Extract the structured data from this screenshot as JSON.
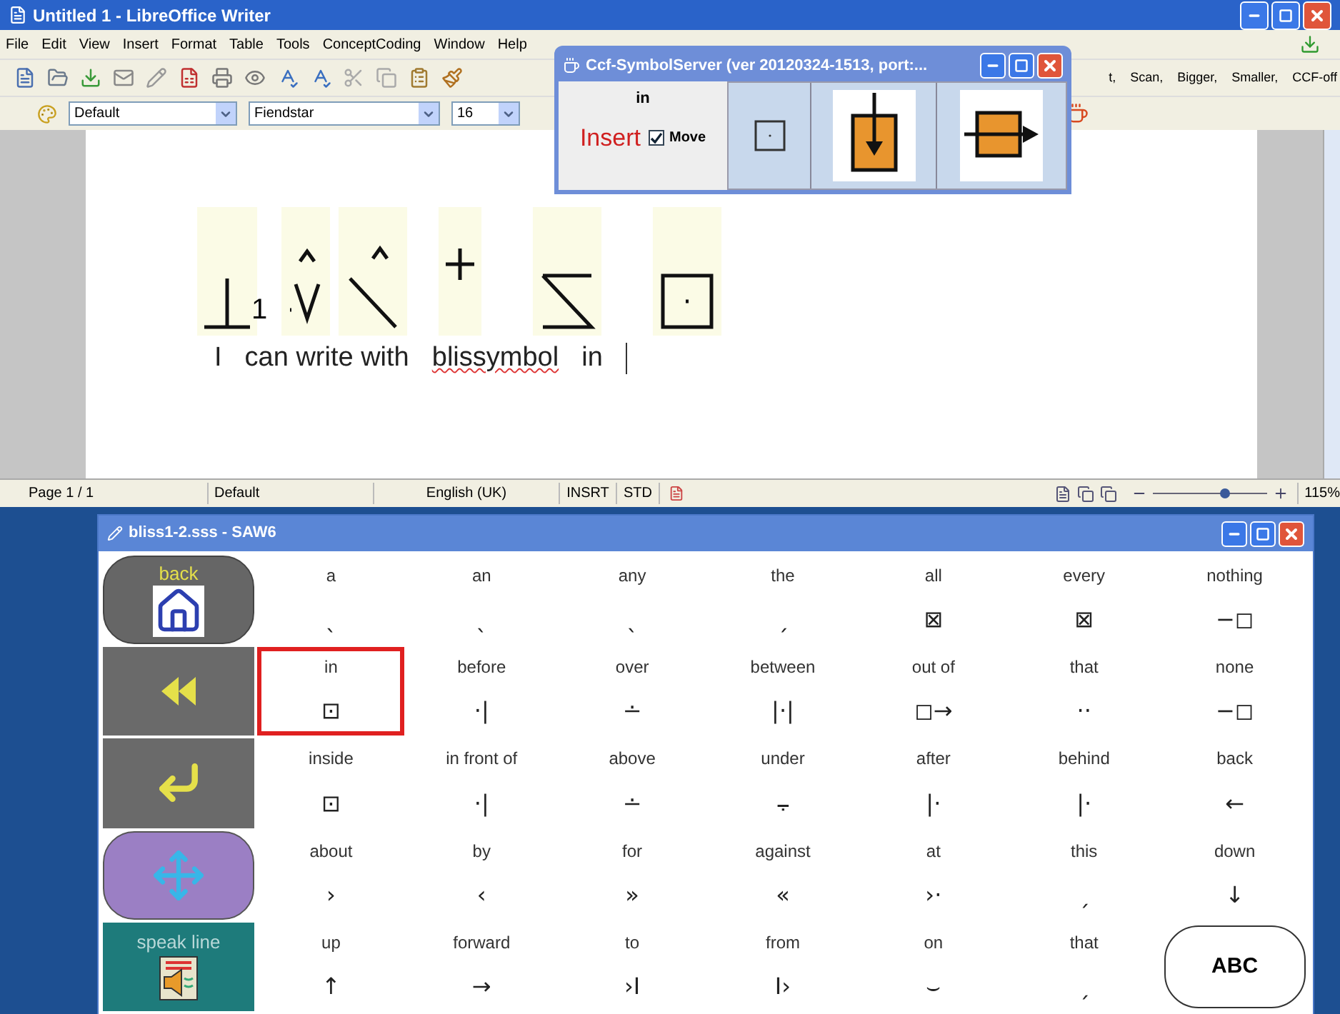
{
  "main_window": {
    "title": "Untitled 1 - LibreOffice Writer"
  },
  "menu": [
    "File",
    "Edit",
    "View",
    "Insert",
    "Format",
    "Table",
    "Tools",
    "ConceptCoding",
    "Window",
    "Help"
  ],
  "toolbar_commands": [
    "t,",
    "Scan,",
    "Bigger,",
    "Smaller,",
    "CCF-off"
  ],
  "format_bar": {
    "style": "Default",
    "font": "Fiendstar",
    "size": "16"
  },
  "symbol_server": {
    "title": "Ccf-SymbolServer (ver 20120324-1513, port:...",
    "word": "in",
    "action": "Insert",
    "move": {
      "label": "Move",
      "checked": true
    }
  },
  "document": {
    "subscript": "1",
    "words": [
      {
        "text": "I",
        "misspelled": false
      },
      {
        "text": "can write with",
        "misspelled": false
      },
      {
        "text": "blissymbol",
        "misspelled": true
      },
      {
        "text": "in",
        "misspelled": false
      }
    ]
  },
  "status_bar": {
    "page": "Page 1 / 1",
    "style": "Default",
    "language": "English (UK)",
    "mode": "INSRT",
    "selection": "STD",
    "zoom": {
      "level": 0.62,
      "reading": "115%"
    }
  },
  "saw": {
    "title": "bliss1-2.sss - SAW6",
    "side_buttons": [
      {
        "kind": "back",
        "label": "back"
      },
      {
        "kind": "rewind"
      },
      {
        "kind": "enter"
      },
      {
        "kind": "move"
      },
      {
        "kind": "speak",
        "label": "speak line"
      }
    ],
    "rows": [
      [
        {
          "word": "a",
          "symbol": "ˎ",
          "selected": false
        },
        {
          "word": "an",
          "symbol": "ˎ",
          "selected": false
        },
        {
          "word": "any",
          "symbol": "ˎ",
          "selected": false
        },
        {
          "word": "the",
          "symbol": "ˏ",
          "selected": false
        },
        {
          "word": "all",
          "symbol": "⊠",
          "selected": false
        },
        {
          "word": "every",
          "symbol": "⊠",
          "selected": false
        },
        {
          "word": "nothing",
          "symbol": "−◻",
          "selected": false
        }
      ],
      [
        {
          "word": "in",
          "symbol": "⊡",
          "selected": true
        },
        {
          "word": "before",
          "symbol": "·|",
          "selected": false
        },
        {
          "word": "over",
          "symbol": "∸",
          "selected": false
        },
        {
          "word": "between",
          "symbol": "|·|",
          "selected": false
        },
        {
          "word": "out of",
          "symbol": "◻→",
          "selected": false
        },
        {
          "word": "that",
          "symbol": "··",
          "selected": false
        },
        {
          "word": "none",
          "symbol": "−◻",
          "selected": false
        }
      ],
      [
        {
          "word": "inside",
          "symbol": "⊡",
          "selected": false
        },
        {
          "word": "in front of",
          "symbol": "·|",
          "selected": false
        },
        {
          "word": "above",
          "symbol": "∸",
          "selected": false
        },
        {
          "word": "under",
          "symbol": "⨪",
          "selected": false
        },
        {
          "word": "after",
          "symbol": "|·",
          "selected": false
        },
        {
          "word": "behind",
          "symbol": "|·",
          "selected": false
        },
        {
          "word": "back",
          "symbol": "←",
          "selected": false
        }
      ],
      [
        {
          "word": "about",
          "symbol": "›",
          "selected": false
        },
        {
          "word": "by",
          "symbol": "‹",
          "selected": false
        },
        {
          "word": "for",
          "symbol": "»",
          "selected": false
        },
        {
          "word": "against",
          "symbol": "«",
          "selected": false
        },
        {
          "word": "at",
          "symbol": "›·",
          "selected": false
        },
        {
          "word": "this",
          "symbol": "ˏ",
          "selected": false
        },
        {
          "word": "down",
          "symbol": "↓",
          "selected": false
        }
      ],
      [
        {
          "word": "up",
          "symbol": "↑",
          "selected": false
        },
        {
          "word": "forward",
          "symbol": "→",
          "selected": false
        },
        {
          "word": "to",
          "symbol": "›I",
          "selected": false
        },
        {
          "word": "from",
          "symbol": "I›",
          "selected": false
        },
        {
          "word": "on",
          "symbol": "⌣",
          "selected": false
        },
        {
          "word": "that",
          "symbol": "ˏ",
          "selected": false
        }
      ]
    ],
    "abc_button": {
      "label": "ABC"
    }
  }
}
